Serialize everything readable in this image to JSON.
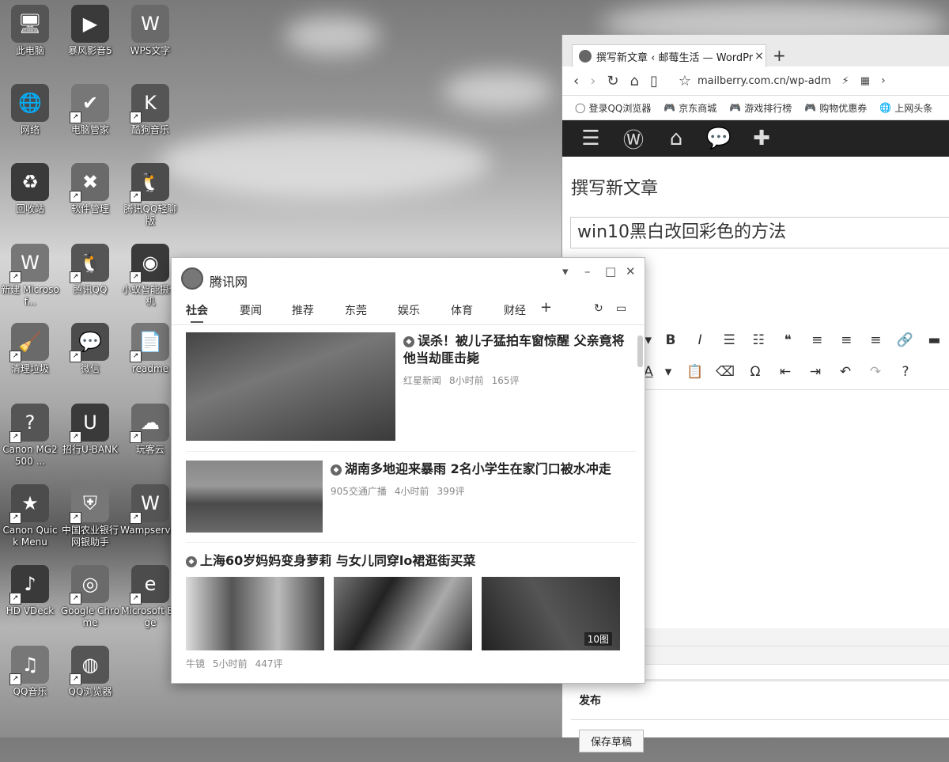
{
  "desktop": {
    "icons": [
      {
        "label": "此电脑",
        "glyph": "🖥"
      },
      {
        "label": "暴风影音5",
        "glyph": "▶"
      },
      {
        "label": "WPS文字",
        "glyph": "W"
      },
      {
        "label": "网络",
        "glyph": "🌐"
      },
      {
        "label": "电脑管家",
        "glyph": "✔"
      },
      {
        "label": "酷狗音乐",
        "glyph": "K"
      },
      {
        "label": "回收站",
        "glyph": "♻"
      },
      {
        "label": "软件管理",
        "glyph": "✖"
      },
      {
        "label": "腾讯QQ轻聊版",
        "glyph": "🐧"
      },
      {
        "label": "新建 Microsof...",
        "glyph": "W"
      },
      {
        "label": "腾讯QQ",
        "glyph": "🐧"
      },
      {
        "label": "小蚁智能摄像机",
        "glyph": "◉"
      },
      {
        "label": "清理垃圾",
        "glyph": "🧹"
      },
      {
        "label": "微信",
        "glyph": "💬"
      },
      {
        "label": "readme",
        "glyph": "📄"
      },
      {
        "label": "Canon MG2500 ...",
        "glyph": "?"
      },
      {
        "label": "招行U-BANK",
        "glyph": "U"
      },
      {
        "label": "玩客云",
        "glyph": "☁"
      },
      {
        "label": "Canon Quick Menu",
        "glyph": "★"
      },
      {
        "label": "中国农业银行网银助手",
        "glyph": "⛨"
      },
      {
        "label": "Wampserver",
        "glyph": "W"
      },
      {
        "label": "HD VDeck",
        "glyph": "♪"
      },
      {
        "label": "Google Chrome",
        "glyph": "◎"
      },
      {
        "label": "Microsoft Edge",
        "glyph": "e"
      },
      {
        "label": "QQ音乐",
        "glyph": "♫"
      },
      {
        "label": "QQ浏览器",
        "glyph": "◍"
      }
    ]
  },
  "browser": {
    "tab_title": "撰写新文章 ‹ 邮莓生活 — WordPress",
    "tab_close": "×",
    "new_tab": "+",
    "url": "mailberry.com.cn/wp-adm",
    "bookmarks": [
      {
        "icon": "◯",
        "label": "登录QQ浏览器"
      },
      {
        "icon": "🎮",
        "label": "京东商城"
      },
      {
        "icon": "🎮",
        "label": "游戏排行榜"
      },
      {
        "icon": "🎮",
        "label": "购物优惠券"
      },
      {
        "icon": "🌐",
        "label": "上网头条"
      }
    ]
  },
  "wordpress": {
    "heading": "撰写新文章",
    "post_title": "win10黑白改回彩色的方法",
    "publish_heading": "发布",
    "save_draft": "保存草稿"
  },
  "news": {
    "app_title": "腾讯网",
    "tabs": [
      "社会",
      "要闻",
      "推荐",
      "东莞",
      "娱乐",
      "体育",
      "财经"
    ],
    "articles": [
      {
        "title": "误杀！被儿子猛拍车窗惊醒 父亲竟将他当劫匪击毙",
        "source": "红星新闻",
        "time": "8小时前",
        "comments": "165评"
      },
      {
        "title": "湖南多地迎来暴雨 2名小学生在家门口被水冲走",
        "source": "905交通广播",
        "time": "4小时前",
        "comments": "399评"
      },
      {
        "title": "上海60岁妈妈变身萝莉 与女儿同穿lo裙逛街买菜",
        "source": "牛镜",
        "time": "5小时前",
        "comments": "447评",
        "image_count": "10图"
      }
    ]
  }
}
